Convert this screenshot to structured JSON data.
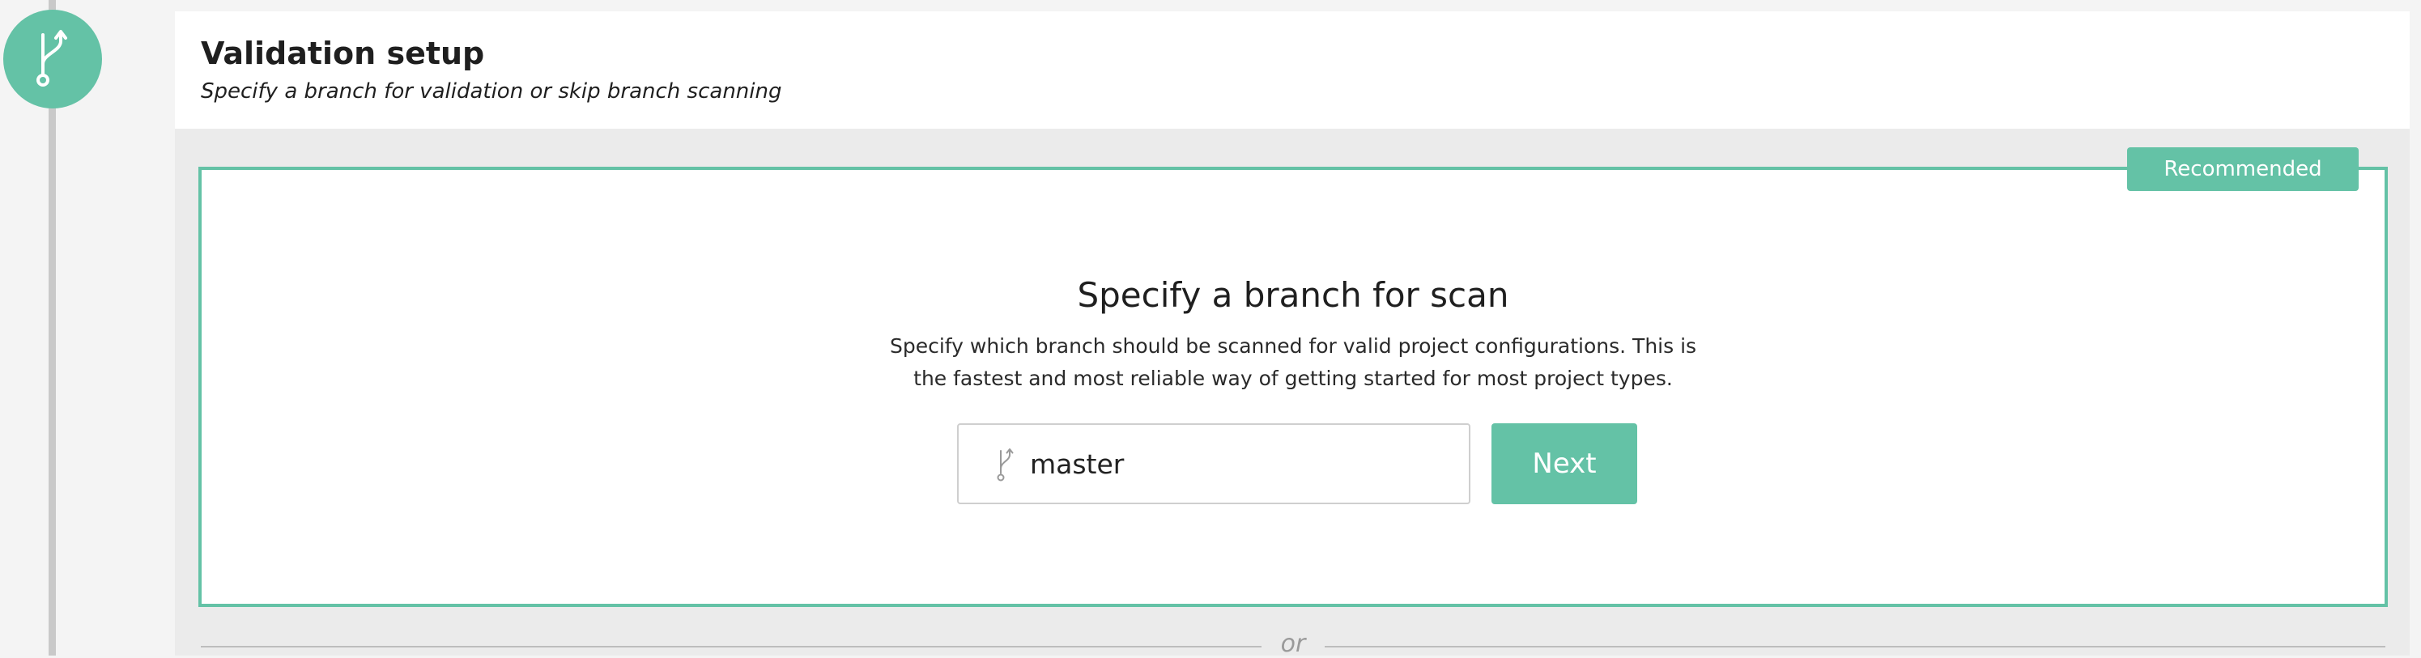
{
  "step": {
    "icon": "git-branch-icon",
    "color": "#64c2a6"
  },
  "header": {
    "title": "Validation setup",
    "subtitle": "Specify a branch for validation or skip branch scanning"
  },
  "scan_option": {
    "badge": "Recommended",
    "title": "Specify a branch for scan",
    "description_line1": "Specify which branch should be scanned for valid project configurations. This is",
    "description_line2": "the fastest and most reliable way of getting started for most project types.",
    "branch_input": {
      "value": "master",
      "icon": "git-branch-icon"
    },
    "next_label": "Next"
  },
  "divider": {
    "label": "or"
  },
  "colors": {
    "accent": "#64c2a6",
    "panel_background": "#ebebeb",
    "page_background": "#f4f4f4"
  }
}
